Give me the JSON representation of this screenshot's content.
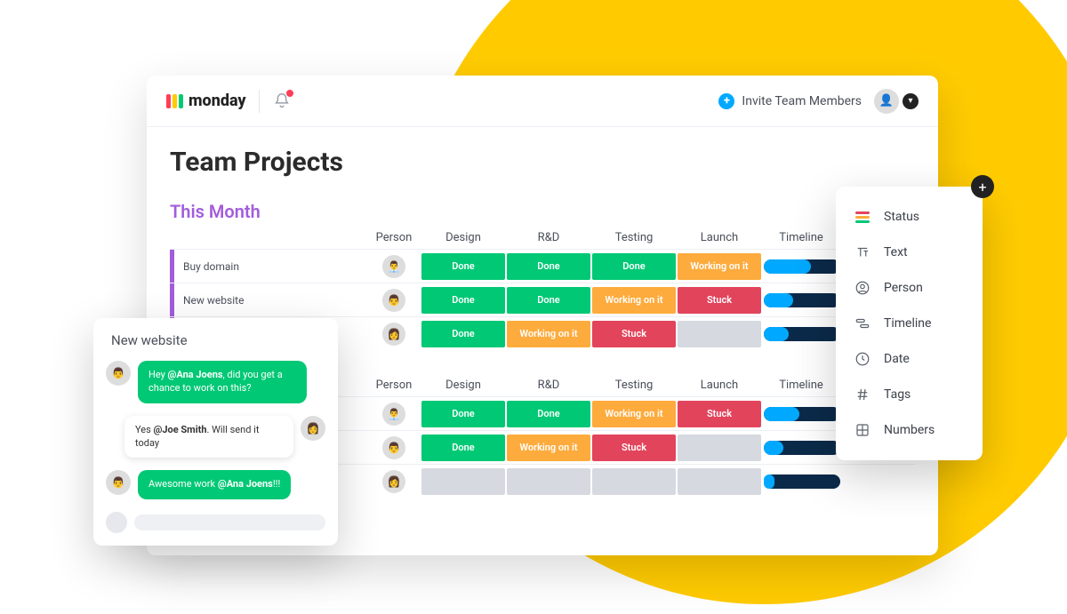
{
  "brand": "monday",
  "header": {
    "invite_label": "Invite Team Members"
  },
  "page_title": "Team Projects",
  "columns": [
    "Person",
    "Design",
    "R&D",
    "Testing",
    "Launch",
    "Timeline"
  ],
  "status_labels": {
    "done": "Done",
    "working": "Working on it",
    "stuck": "Stuck"
  },
  "groups": [
    {
      "title": "This Month",
      "rows": [
        {
          "name": "Buy domain",
          "person": "👨‍💼",
          "cells": [
            "done",
            "done",
            "done",
            "working"
          ],
          "timeline": 62
        },
        {
          "name": "New website",
          "person": "👨",
          "cells": [
            "done",
            "done",
            "working",
            "stuck"
          ],
          "timeline": 38
        },
        {
          "name": "",
          "person": "👩",
          "cells": [
            "done",
            "working",
            "stuck",
            "empty"
          ],
          "timeline": 32
        }
      ]
    },
    {
      "title": "",
      "rows": [
        {
          "name": "",
          "person": "👨‍💼",
          "cells": [
            "done",
            "done",
            "working",
            "stuck"
          ],
          "timeline": 46
        },
        {
          "name": "",
          "person": "👨",
          "cells": [
            "done",
            "working",
            "stuck",
            "empty"
          ],
          "timeline": 26
        },
        {
          "name": "",
          "person": "👩",
          "cells": [
            "empty",
            "empty",
            "empty",
            "empty"
          ],
          "timeline": 14
        }
      ]
    }
  ],
  "chat": {
    "title": "New website",
    "messages": [
      {
        "side": "left",
        "style": "green",
        "text_pre": "Hey ",
        "mention": "@Ana Joens",
        "text_post": ", did you get a chance to work on this?"
      },
      {
        "side": "right",
        "style": "white",
        "text_pre": "Yes ",
        "mention": "@Joe Smith",
        "text_post": ". Will send it today"
      },
      {
        "side": "left",
        "style": "green",
        "text_pre": "Awesome work ",
        "mention": "@Ana Joens",
        "text_post": "!!!"
      }
    ]
  },
  "picker": {
    "items": [
      {
        "key": "status",
        "label": "Status"
      },
      {
        "key": "text",
        "label": "Text"
      },
      {
        "key": "person",
        "label": "Person"
      },
      {
        "key": "timeline",
        "label": "Timeline"
      },
      {
        "key": "date",
        "label": "Date"
      },
      {
        "key": "tags",
        "label": "Tags"
      },
      {
        "key": "numbers",
        "label": "Numbers"
      }
    ]
  }
}
